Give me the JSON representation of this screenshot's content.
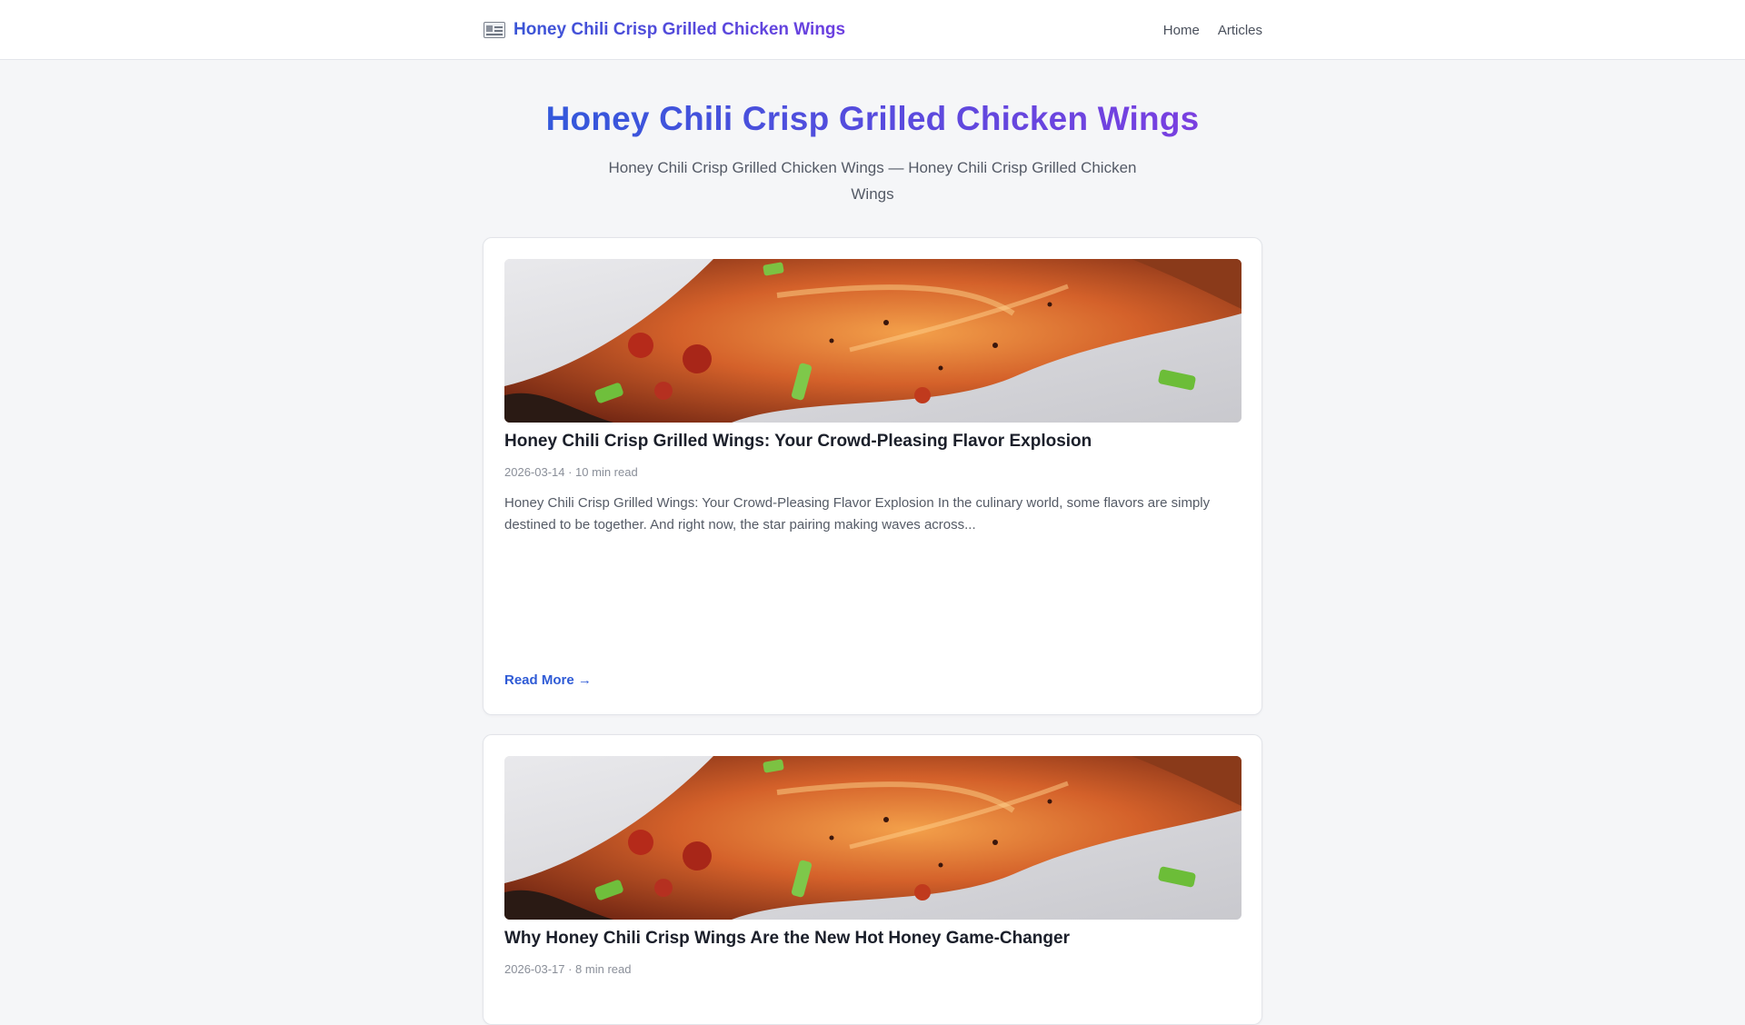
{
  "header": {
    "brand_icon": "newspaper-icon",
    "brand_title": "Honey Chili Crisp Grilled Chicken Wings",
    "nav": [
      {
        "label": "Home"
      },
      {
        "label": "Articles"
      }
    ]
  },
  "hero": {
    "title": "Honey Chili Crisp Grilled Chicken Wings",
    "subtitle": "Honey Chili Crisp Grilled Chicken Wings — Honey Chili Crisp Grilled Chicken Wings"
  },
  "articles": [
    {
      "title": "Honey Chili Crisp Grilled Wings: Your Crowd-Pleasing Flavor Explosion",
      "meta": "2026-03-14 · 10 min read",
      "excerpt": "Honey Chili Crisp Grilled Wings: Your Crowd-Pleasing Flavor Explosion In the culinary world, some flavors are simply destined to be together. And right now, the star pairing making waves across...",
      "read_more": "Read More →"
    },
    {
      "title": "Why Honey Chili Crisp Wings Are the New Hot Honey Game-Changer",
      "meta": "2026-03-17 · 8 min read"
    }
  ],
  "colors": {
    "accent_start": "#3358db",
    "accent_end": "#7a3fe0",
    "link": "#2f5bd6"
  }
}
